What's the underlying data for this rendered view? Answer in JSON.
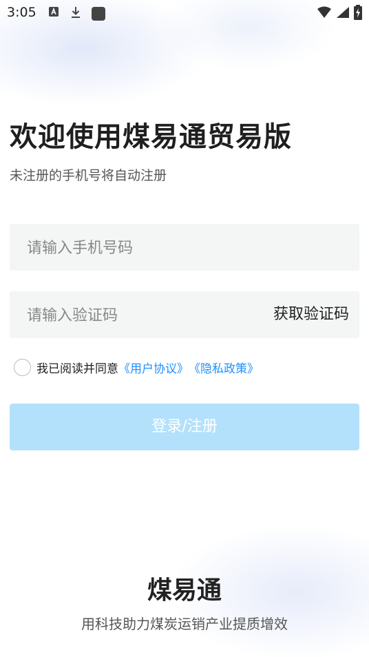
{
  "status_bar": {
    "time": "3:05",
    "left_icons": [
      "text-a-icon",
      "download-icon",
      "square-icon"
    ],
    "right_icons": [
      "wifi-icon",
      "signal-icon",
      "battery-charging-icon"
    ]
  },
  "header": {
    "title": "欢迎使用煤易通贸易版",
    "subtitle": "未注册的手机号将自动注册"
  },
  "form": {
    "phone_placeholder": "请输入手机号码",
    "code_placeholder": "请输入验证码",
    "get_code_label": "获取验证码"
  },
  "agreement": {
    "checked": false,
    "text": "我已阅读并同意",
    "user_agreement_link": "《用户协议》",
    "privacy_link": "《隐私政策》"
  },
  "login_button": {
    "label": "登录/注册"
  },
  "footer": {
    "brand": "煤易通",
    "slogan": "用科技助力煤炭运销产业提质增效"
  },
  "colors": {
    "link": "#1e90ff",
    "button_disabled": "#b3e1fb",
    "field_bg": "#f4f5f5"
  }
}
